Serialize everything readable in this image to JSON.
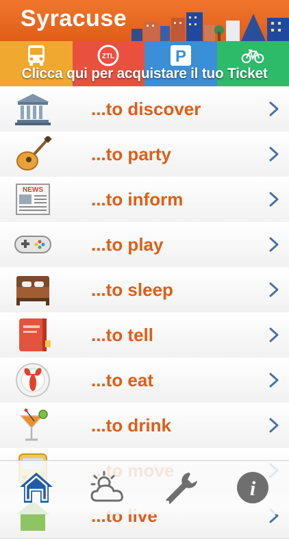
{
  "header": {
    "title": "Syracuse"
  },
  "ticket_bar": {
    "label": "Clicca qui per acquistare il tuo Ticket",
    "services": [
      {
        "name": "bus-icon",
        "color": "#f0a830"
      },
      {
        "name": "ztl-icon",
        "label": "ZTL",
        "color": "#e9503e"
      },
      {
        "name": "parking-icon",
        "label": "P",
        "color": "#3a8fd6"
      },
      {
        "name": "bike-icon",
        "color": "#2dbb6a"
      }
    ]
  },
  "menu": {
    "items": [
      {
        "label": "...to discover",
        "icon": "museum-icon"
      },
      {
        "label": "...to party",
        "icon": "guitar-icon"
      },
      {
        "label": "...to inform",
        "icon": "newspaper-icon",
        "icon_text": "NEWS"
      },
      {
        "label": "...to play",
        "icon": "gamepad-icon"
      },
      {
        "label": "...to sleep",
        "icon": "bed-icon"
      },
      {
        "label": "...to tell",
        "icon": "notebook-icon"
      },
      {
        "label": "...to eat",
        "icon": "lobster-plate-icon"
      },
      {
        "label": "...to drink",
        "icon": "cocktail-icon"
      },
      {
        "label": "...to move",
        "icon": "bus-icon"
      },
      {
        "label": "...to live",
        "icon": "house-icon"
      }
    ]
  },
  "tabbar": {
    "tabs": [
      {
        "name": "home-icon",
        "active": true
      },
      {
        "name": "weather-icon",
        "active": false
      },
      {
        "name": "wrench-icon",
        "active": false
      },
      {
        "name": "info-icon",
        "label": "i",
        "active": false
      }
    ]
  },
  "colors": {
    "brand_orange": "#e15d17",
    "active_tab": "#1f5da8",
    "inactive_tab": "#6f6f6f",
    "chevron": "#4a72a6"
  }
}
